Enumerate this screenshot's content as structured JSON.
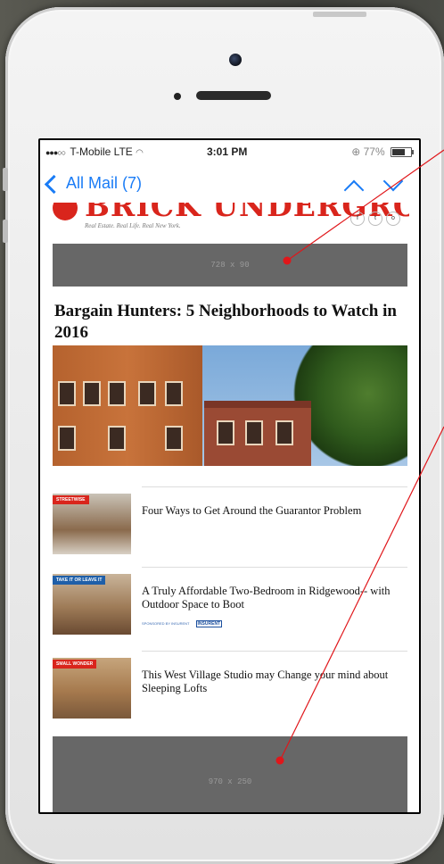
{
  "status_bar": {
    "signal_dots": "●●●○○",
    "carrier": "T-Mobile",
    "network": "LTE",
    "time": "3:01 PM",
    "battery_text": "77%",
    "battery_level": 0.77
  },
  "nav": {
    "back_label": "All Mail (7)"
  },
  "masthead": {
    "brand": "BRICK UNDERGROUND",
    "tagline": "Real Estate. Real Life. Real New York.",
    "socials": [
      "f",
      "t",
      "o"
    ]
  },
  "ads": {
    "top_label": "728 x 90",
    "bottom_label": "970 x 250"
  },
  "headline": "Bargain Hunters: 5 Neighborhoods to Watch in 2016",
  "articles": [
    {
      "tag": "STREETWISE",
      "tag_color": "#d9251c",
      "title": "Four Ways to Get Around the Guarantor Problem"
    },
    {
      "tag": "TAKE IT OR LEAVE IT",
      "tag_color": "#1f5fa8",
      "title": "A Truly Affordable Two-Bedroom in Ridgewood-- with Outdoor Space to Boot",
      "sponsor": "SPONSORED BY INSURENT",
      "sponsor_logo": "INSURENT"
    },
    {
      "tag": "SMALL WONDER",
      "tag_color": "#d9251c",
      "title": "This West Village Studio may Change your mind about Sleeping Lofts"
    }
  ],
  "colors": {
    "ios_blue": "#1a7cf6",
    "brand_red": "#d9251c",
    "ad_gray": "#676767",
    "pointer_red": "#e0161a"
  }
}
